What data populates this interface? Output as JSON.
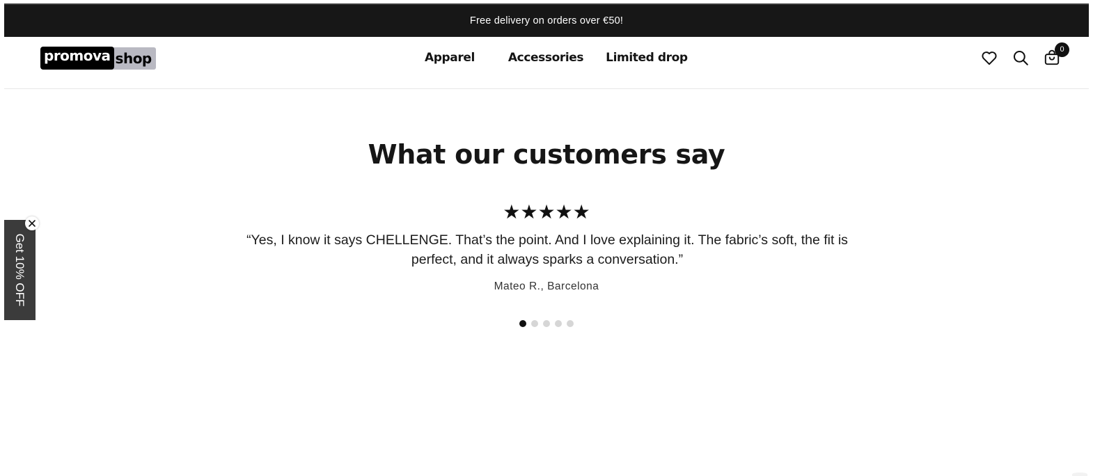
{
  "announcement": {
    "text": "Free delivery on orders over €50!"
  },
  "header": {
    "logo": {
      "part1": "promova",
      "part2": "shop"
    },
    "nav": [
      {
        "label": "Apparel"
      },
      {
        "label": "Accessories"
      },
      {
        "label": "Limited drop"
      }
    ],
    "icons": [
      "heart-icon",
      "search-icon",
      "cart-icon"
    ],
    "cart_count": "0"
  },
  "testimonials": {
    "title": "What our customers say",
    "rating": "★★★★★",
    "quote": "“Yes, I know it says CHELLENGE. That’s the point. And I love explaining it. The fabric’s soft, the fit is perfect, and it always sparks a conversation.”",
    "author": "Mateo R., Barcelona",
    "slides_total": 5,
    "active_slide": 1
  },
  "side_tab": {
    "label": "Get 10% OFF"
  },
  "colors": {
    "announcement_bg": "#171717",
    "side_tab_bg": "#3b3b3b",
    "dot_active": "#111111",
    "dot_inactive": "#d6d6d6"
  }
}
